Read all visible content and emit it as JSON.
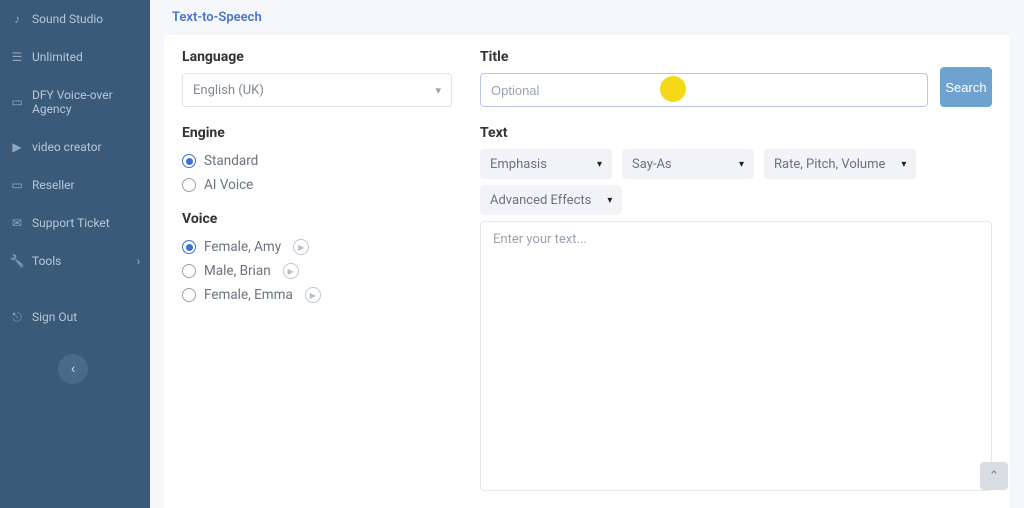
{
  "sidebar": {
    "items": [
      {
        "label": "Sound Studio"
      },
      {
        "label": "Unlimited"
      },
      {
        "label": "DFY Voice-over Agency"
      },
      {
        "label": "video creator"
      },
      {
        "label": "Reseller"
      },
      {
        "label": "Support Ticket"
      },
      {
        "label": "Tools"
      },
      {
        "label": "Sign Out"
      }
    ]
  },
  "breadcrumb": "Text-to-Speech",
  "form": {
    "language_label": "Language",
    "language_value": "English (UK)",
    "engine_label": "Engine",
    "engine_options": [
      "Standard",
      "AI Voice"
    ],
    "engine_selected": "Standard",
    "voice_label": "Voice",
    "voice_options": [
      "Female, Amy",
      "Male, Brian",
      "Female, Emma"
    ],
    "voice_selected": "Female, Amy",
    "title_label": "Title",
    "title_placeholder": "Optional",
    "search_label": "Search",
    "text_label": "Text",
    "dropdowns": {
      "emphasis": "Emphasis",
      "sayas": "Say-As",
      "rpv": "Rate, Pitch, Volume",
      "advanced": "Advanced Effects"
    },
    "text_placeholder": "Enter your text..."
  }
}
